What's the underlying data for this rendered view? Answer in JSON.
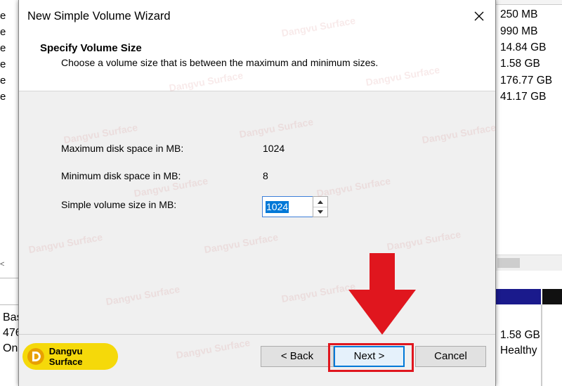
{
  "background": {
    "left_rows": [
      "e",
      "e",
      "e",
      "e",
      "e",
      "e"
    ],
    "left_disk_lines": [
      "Bas",
      "476",
      "Onl"
    ],
    "scroll_left_arrow": "<",
    "right_sizes": [
      "250 MB",
      "990 MB",
      "14.84 GB",
      "1.58 GB",
      "176.77 GB",
      "41.17 GB"
    ],
    "right_bottom": [
      "1.58 GB",
      "Healthy"
    ]
  },
  "dialog": {
    "title": "New Simple Volume Wizard",
    "close_glyph": "✕",
    "header_title": "Specify Volume Size",
    "header_subtitle": "Choose a volume size that is between the maximum and minimum sizes.",
    "max_label": "Maximum disk space in MB:",
    "max_value": "1024",
    "min_label": "Minimum disk space in MB:",
    "min_value": "8",
    "size_label": "Simple volume size in MB:",
    "size_value": "1024",
    "back_label": "< Back",
    "next_label": "Next >",
    "cancel_label": "Cancel"
  },
  "branding": {
    "logo_text": "Dangvu Surface",
    "watermark_text": "Dangvu Surface",
    "logo_color": "#f5d90a"
  },
  "colors": {
    "highlight": "#e0161e",
    "accent": "#0078d7"
  }
}
